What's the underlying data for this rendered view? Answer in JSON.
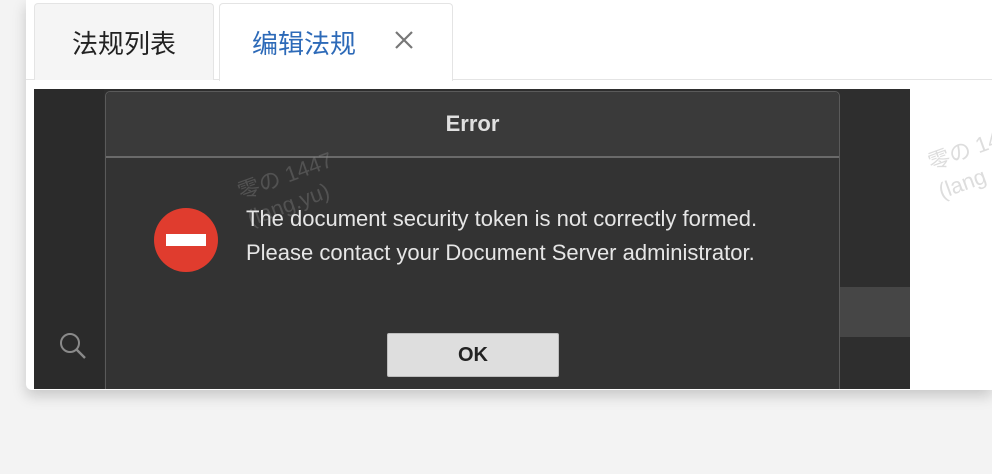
{
  "tabs": [
    {
      "label": "法规列表"
    },
    {
      "label": "编辑法规"
    }
  ],
  "watermark": {
    "line1": "零の 1447",
    "line2": "(lang.yu)",
    "right_line1": "零の 14",
    "right_line2": "(lang"
  },
  "dialog": {
    "title": "Error",
    "message_line1": "The document security token is not correctly formed.",
    "message_line2": "Please contact your Document Server administrator.",
    "ok_label": "OK"
  },
  "icons": {
    "close": "close-icon",
    "search": "search-icon",
    "error": "error-icon"
  },
  "colors": {
    "active_tab_text": "#2d6ab8",
    "error_red": "#e03c2e",
    "dialog_bg": "#333333"
  }
}
